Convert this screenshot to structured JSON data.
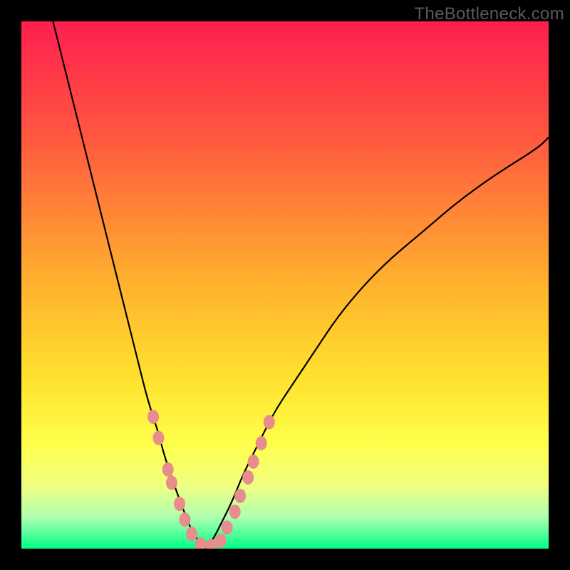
{
  "watermark": "TheBottleneck.com",
  "chart_data": {
    "type": "line",
    "title": "",
    "xlabel": "",
    "ylabel": "",
    "xlim": [
      0,
      100
    ],
    "ylim": [
      0,
      100
    ],
    "gradient": {
      "stops": [
        {
          "pct": 0,
          "color": "#ff1e4f"
        },
        {
          "pct": 22,
          "color": "#ff5840"
        },
        {
          "pct": 50,
          "color": "#ffb22e"
        },
        {
          "pct": 68,
          "color": "#ffe22e"
        },
        {
          "pct": 80,
          "color": "#ffff4a"
        },
        {
          "pct": 88,
          "color": "#f0ff80"
        },
        {
          "pct": 94,
          "color": "#b0ffb0"
        },
        {
          "pct": 100,
          "color": "#00ff88"
        }
      ]
    },
    "series": [
      {
        "name": "left-curve",
        "x": [
          6,
          8,
          10,
          12,
          14,
          16,
          18,
          20,
          22,
          24,
          26,
          27,
          29,
          30.5,
          32,
          33.5,
          35
        ],
        "y": [
          100,
          92,
          84,
          76,
          68,
          60,
          52,
          44,
          36,
          28,
          22,
          18,
          12,
          8,
          4,
          1.5,
          0
        ]
      },
      {
        "name": "right-curve",
        "x": [
          35,
          36.5,
          38,
          40,
          42,
          45,
          48,
          52,
          56,
          60,
          65,
          70,
          76,
          83,
          90,
          98,
          100
        ],
        "y": [
          0,
          2,
          5,
          9,
          14,
          20,
          26,
          32,
          38,
          44,
          50,
          55,
          60,
          66,
          71,
          76,
          78
        ]
      }
    ],
    "markers": {
      "name": "data-points",
      "color": "#e98c8c",
      "radius_x": 8,
      "radius_y": 10,
      "points": [
        {
          "x": 25,
          "y": 25
        },
        {
          "x": 26,
          "y": 21
        },
        {
          "x": 27.8,
          "y": 15
        },
        {
          "x": 28.5,
          "y": 12.5
        },
        {
          "x": 30,
          "y": 8.5
        },
        {
          "x": 31,
          "y": 5.5
        },
        {
          "x": 32.3,
          "y": 2.8
        },
        {
          "x": 34,
          "y": 0.8
        },
        {
          "x": 36,
          "y": 0.5
        },
        {
          "x": 37.8,
          "y": 1.5
        },
        {
          "x": 39,
          "y": 4
        },
        {
          "x": 40.5,
          "y": 7
        },
        {
          "x": 41.5,
          "y": 10
        },
        {
          "x": 43,
          "y": 13.5
        },
        {
          "x": 44,
          "y": 16.5
        },
        {
          "x": 45.5,
          "y": 20
        },
        {
          "x": 47,
          "y": 24
        }
      ]
    }
  }
}
